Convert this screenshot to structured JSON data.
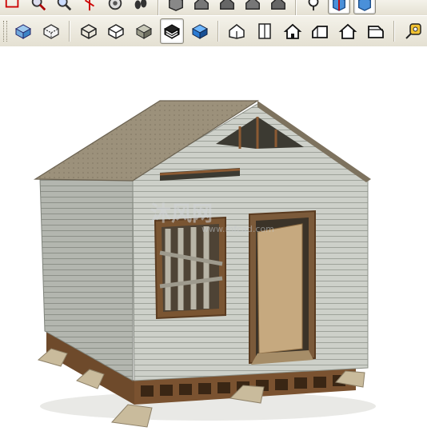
{
  "toolbar_top": {
    "buttons": [
      {
        "icon": "rectangle-tool-icon"
      },
      {
        "icon": "zoom-tool-icon"
      },
      {
        "icon": "zoom-window-icon"
      },
      {
        "icon": "zoom-extents-icon"
      },
      {
        "icon": "orbit-icon"
      },
      {
        "icon": "walk-icon"
      },
      {
        "icon": "component-icon"
      },
      {
        "icon": "house-view-icon"
      },
      {
        "icon": "house-view-2-icon"
      },
      {
        "icon": "house-view-3-icon"
      },
      {
        "icon": "house-view-4-icon"
      },
      {
        "icon": "position-camera-icon"
      },
      {
        "icon": "section-blue-icon"
      },
      {
        "icon": "section-active-icon"
      }
    ]
  },
  "toolbar_styles": {
    "buttons": [
      {
        "icon": "xray-style-icon"
      },
      {
        "icon": "back-edges-style-icon"
      },
      {
        "icon": "wireframe-style-icon"
      },
      {
        "icon": "hidden-line-style-icon"
      },
      {
        "icon": "shaded-style-icon"
      },
      {
        "icon": "shaded-textures-style-icon",
        "active": true
      },
      {
        "icon": "monochrome-style-icon"
      }
    ]
  },
  "toolbar_views": {
    "buttons": [
      {
        "icon": "iso-view-icon"
      },
      {
        "icon": "top-view-icon"
      },
      {
        "icon": "front-view-icon"
      },
      {
        "icon": "right-view-icon"
      },
      {
        "icon": "back-view-icon"
      },
      {
        "icon": "left-view-icon"
      }
    ]
  },
  "toolbar_measure": {
    "buttons": [
      {
        "icon": "tape-measure-icon"
      }
    ]
  },
  "viewport": {
    "watermark_main": "沐风网",
    "watermark_sub": "www.mfcad.com",
    "colors": {
      "roof": "#9a8f78",
      "siding": "#c9ccc6",
      "siding_shadow": "#a8aca6",
      "wood": "#8a5a34",
      "door": "#c8ab80",
      "footing": "#c7b89a"
    }
  }
}
